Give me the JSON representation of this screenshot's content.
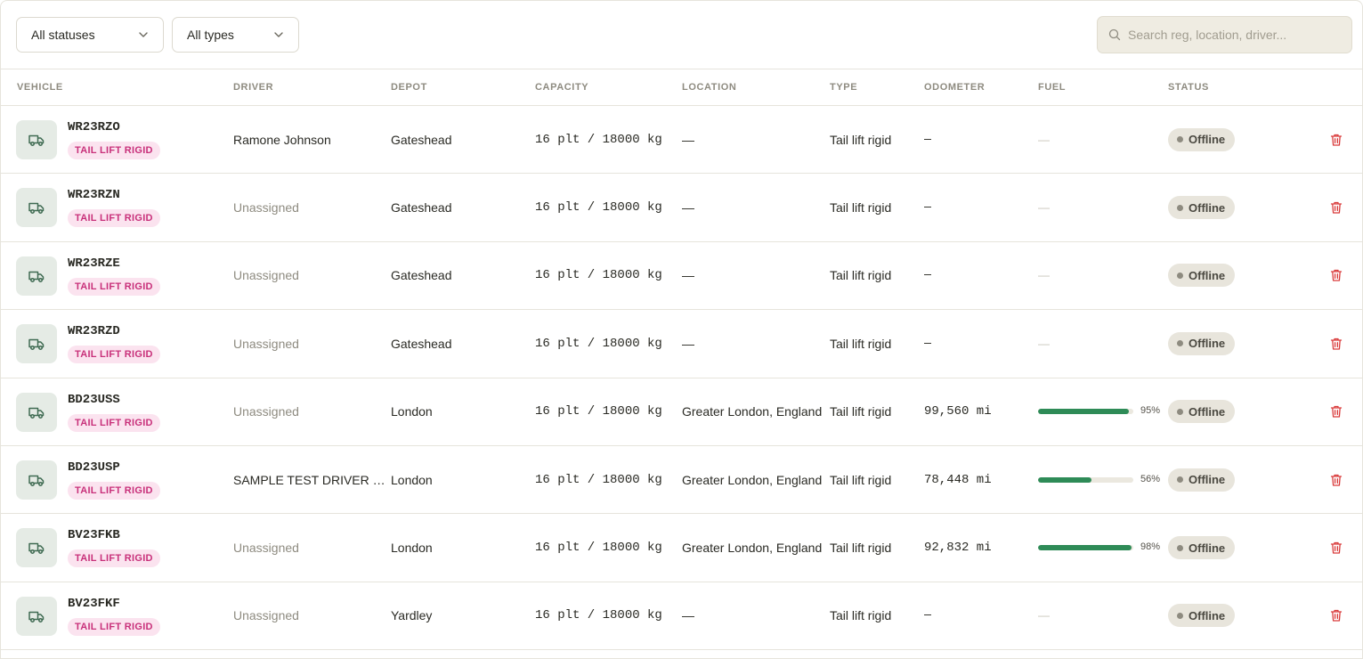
{
  "filters": {
    "status": "All statuses",
    "type": "All types",
    "search_placeholder": "Search reg, location, driver..."
  },
  "columns": {
    "vehicle": "VEHICLE",
    "driver": "DRIVER",
    "depot": "DEPOT",
    "capacity": "CAPACITY",
    "location": "LOCATION",
    "type": "TYPE",
    "odometer": "ODOMETER",
    "fuel": "FUEL",
    "status": "STATUS"
  },
  "colors": {
    "badge_bg": "#fbe3ef",
    "badge_text": "#c8307a",
    "fuel_fill": "#2e8b57",
    "trash": "#d93a3a"
  },
  "rows": [
    {
      "reg": "WR23RZO",
      "badge": "TAIL LIFT RIGID",
      "driver": "Ramone Johnson",
      "assigned": true,
      "depot": "Gateshead",
      "capacity": "16 plt / 18000 kg",
      "location": "—",
      "type": "Tail lift rigid",
      "odometer": "—",
      "fuel": null,
      "fuel_label": "—",
      "status": "Offline"
    },
    {
      "reg": "WR23RZN",
      "badge": "TAIL LIFT RIGID",
      "driver": "Unassigned",
      "assigned": false,
      "depot": "Gateshead",
      "capacity": "16 plt / 18000 kg",
      "location": "—",
      "type": "Tail lift rigid",
      "odometer": "—",
      "fuel": null,
      "fuel_label": "—",
      "status": "Offline"
    },
    {
      "reg": "WR23RZE",
      "badge": "TAIL LIFT RIGID",
      "driver": "Unassigned",
      "assigned": false,
      "depot": "Gateshead",
      "capacity": "16 plt / 18000 kg",
      "location": "—",
      "type": "Tail lift rigid",
      "odometer": "—",
      "fuel": null,
      "fuel_label": "—",
      "status": "Offline"
    },
    {
      "reg": "WR23RZD",
      "badge": "TAIL LIFT RIGID",
      "driver": "Unassigned",
      "assigned": false,
      "depot": "Gateshead",
      "capacity": "16 plt / 18000 kg",
      "location": "—",
      "type": "Tail lift rigid",
      "odometer": "—",
      "fuel": null,
      "fuel_label": "—",
      "status": "Offline"
    },
    {
      "reg": "BD23USS",
      "badge": "TAIL LIFT RIGID",
      "driver": "Unassigned",
      "assigned": false,
      "depot": "London",
      "capacity": "16 plt / 18000 kg",
      "location": "Greater London, England",
      "type": "Tail lift rigid",
      "odometer": "99,560 mi",
      "fuel": 95,
      "fuel_label": "95%",
      "status": "Offline"
    },
    {
      "reg": "BD23USP",
      "badge": "TAIL LIFT RIGID",
      "driver": "SAMPLE TEST DRIVER (BETA)",
      "assigned": true,
      "depot": "London",
      "capacity": "16 plt / 18000 kg",
      "location": "Greater London, England",
      "type": "Tail lift rigid",
      "odometer": "78,448 mi",
      "fuel": 56,
      "fuel_label": "56%",
      "status": "Offline"
    },
    {
      "reg": "BV23FKB",
      "badge": "TAIL LIFT RIGID",
      "driver": "Unassigned",
      "assigned": false,
      "depot": "London",
      "capacity": "16 plt / 18000 kg",
      "location": "Greater London, England",
      "type": "Tail lift rigid",
      "odometer": "92,832 mi",
      "fuel": 98,
      "fuel_label": "98%",
      "status": "Offline"
    },
    {
      "reg": "BV23FKF",
      "badge": "TAIL LIFT RIGID",
      "driver": "Unassigned",
      "assigned": false,
      "depot": "Yardley",
      "capacity": "16 plt / 18000 kg",
      "location": "—",
      "type": "Tail lift rigid",
      "odometer": "—",
      "fuel": null,
      "fuel_label": "—",
      "status": "Offline"
    }
  ]
}
